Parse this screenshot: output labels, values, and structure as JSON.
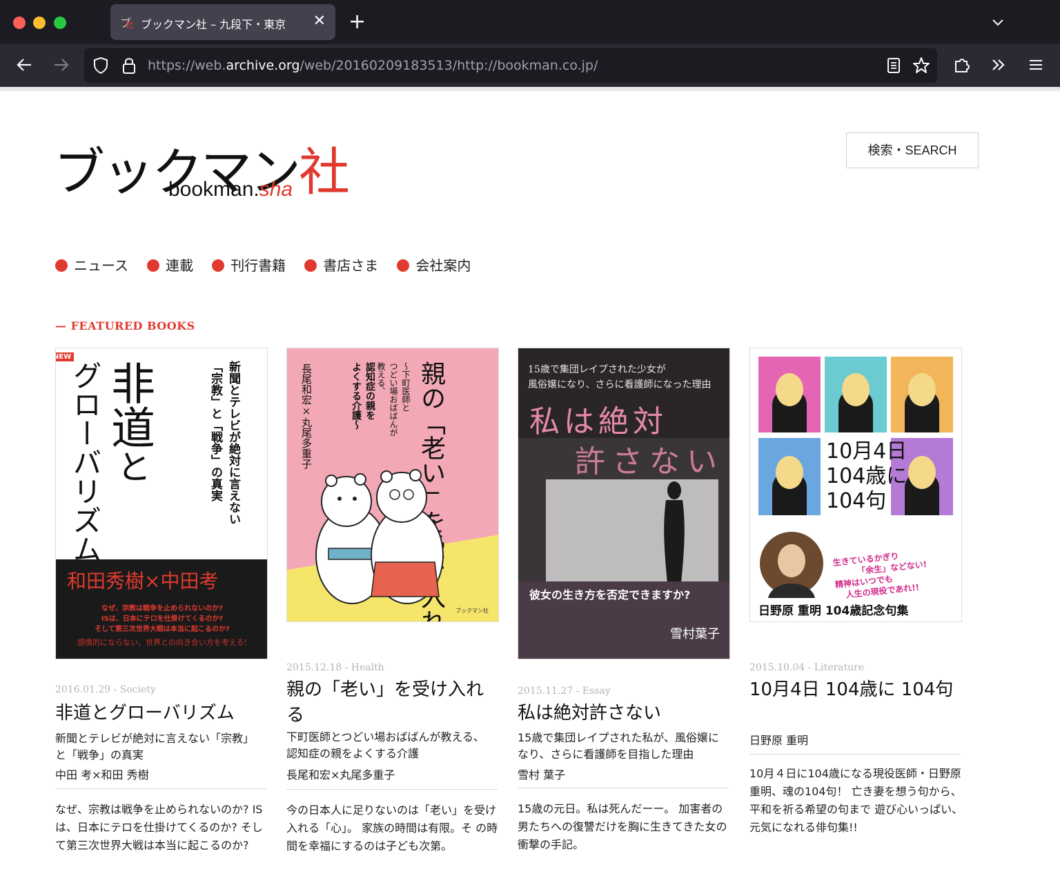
{
  "browser": {
    "tab_title": "ブックマン社 – 九段下・東京",
    "url_prefix": "https://web.",
    "url_domain": "archive.org",
    "url_rest": "/web/20160209183513/http://bookman.co.jp/"
  },
  "site": {
    "logo_jp_main": "ブックマン",
    "logo_jp_red": "社",
    "logo_en_main": "bookman.",
    "logo_en_red": "sha",
    "search_label": "検索・SEARCH"
  },
  "nav": [
    {
      "label": "ニュース"
    },
    {
      "label": "連載"
    },
    {
      "label": "刊行書籍"
    },
    {
      "label": "書店さま"
    },
    {
      "label": "会社案内"
    }
  ],
  "featured_label": "— FEATURED BOOKS",
  "books": [
    {
      "meta": "2016.01.29 - Society",
      "title": "非道とグローバリズム",
      "subtitle": "新聞とテレビが絶対に言えない「宗教」と「戦争」の真実",
      "author": "中田 考×和田 秀樹",
      "description": "なぜ、宗教は戦争を止められないのか? ISは、日本にテロを仕掛けてくるのか? そして第三次世界大戦は本当に起こるのか?",
      "cover": {
        "badge": "NEW",
        "title_a": "非道",
        "title_b": "と",
        "title_c": "グローバリズム",
        "tagline": "新聞とテレビが絶対に言えない",
        "tagline2": "「宗教」と「戦争」の真実",
        "authors": "和田秀樹×中田考",
        "lines": [
          "なぜ、宗教は戦争を止められないのか?",
          "ISは、日本にテロを仕掛けてくるのか?",
          "そして第三次世界大戦は本当に起こるのか?",
          "感情的にならない、世界との向き合い方を考える!"
        ]
      }
    },
    {
      "meta": "2015.12.18 - Health",
      "title": "親の「老い」を受け入れる",
      "subtitle": "下町医師とつどい場おばばんが教える、認知症の親をよくする介護",
      "author": "長尾和宏×丸尾多重子",
      "description": "今の日本人に足りないのは「老い」を受け入れる「心」。 家族の時間は有限。そ の時間を幸福にするのは子ども次第。",
      "cover": {
        "title": "親の「老い」を受け入れる",
        "sub1": "〜下町医師と",
        "sub2": "つどい場おばばんが",
        "sub3": "教える、",
        "sub4": "認知症の親を",
        "sub5": "よくする介護〜",
        "authors": "長尾和宏×丸尾多重子",
        "publisher": "ブックマン社"
      }
    },
    {
      "meta": "2015.11.27 - Essay",
      "title": "私は絶対許さない",
      "subtitle": "15歳で集団レイプされた私が、風俗嬢になり、さらに看護師を目指した理由",
      "author": "雪村 葉子",
      "description": "15歳の元日。私は死んだーー。 加害者の男たちへの復讐だけを胸に生きてきた女の衝撃の手記。",
      "cover": {
        "top1": "15歳で集団レイプされた少女が",
        "top2": "風俗嬢になり、さらに看護師になった理由",
        "title1": "私は絶対",
        "title2": "許さない",
        "banner": "彼女の生き方を否定できますか?",
        "author": "雪村葉子"
      }
    },
    {
      "meta": "2015.10.04 - Literature",
      "title": "10月4日 104歳に 104句",
      "subtitle": "",
      "author": "日野原 重明",
      "description": "10月４日に104歳になる現役医師・日野原重明、魂の104句！ 亡き妻を想う句から、平和を祈る希望の句まで 遊び心いっぱい、元気になれる俳句集!!",
      "cover": {
        "num1": "10月4日",
        "num2": "104歳に",
        "num3": "104句",
        "quote1": "生きているかぎり",
        "quote2": "「余生」などない!",
        "quote3": "精神はいつでも",
        "quote4": "人生の現役であれ!!",
        "bottom": "日野原 重明 104歳記念句集"
      }
    }
  ],
  "colors": {
    "accent": "#e03a2f",
    "chrome_dark": "#1c1b22",
    "chrome_nav": "#2b2a33"
  }
}
